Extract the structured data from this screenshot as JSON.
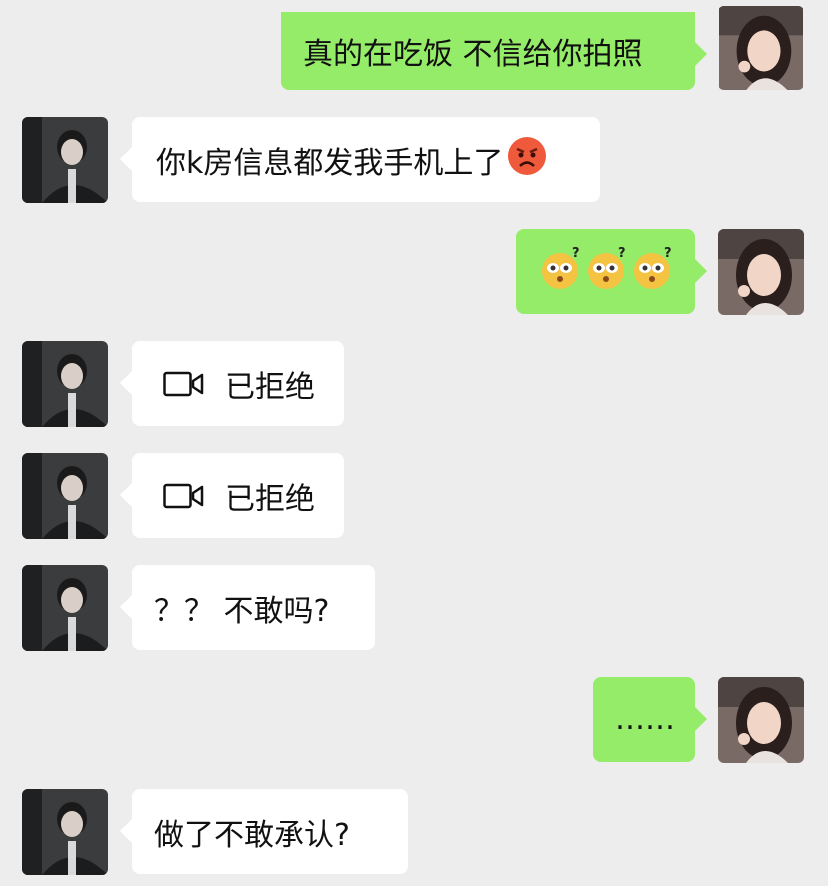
{
  "messages": [
    {
      "side": "out",
      "text": "真的在吃饭 不信给你拍照"
    },
    {
      "side": "in",
      "text": "你k房信息都发我手机上了",
      "emoji": "angry-face-icon"
    },
    {
      "side": "out",
      "emojis": [
        "confused-face-icon",
        "confused-face-icon",
        "confused-face-icon"
      ]
    },
    {
      "side": "in",
      "type": "video-call",
      "text": "已拒绝",
      "icon": "video-camera-icon"
    },
    {
      "side": "in",
      "type": "video-call",
      "text": "已拒绝",
      "icon": "video-camera-icon"
    },
    {
      "side": "in",
      "text": "？？ 不敢吗?"
    },
    {
      "side": "out",
      "text": "……"
    },
    {
      "side": "in",
      "text": "做了不敢承认?"
    }
  ],
  "colors": {
    "background": "#ededed",
    "outgoing": "#95ec69",
    "incoming": "#ffffff"
  }
}
